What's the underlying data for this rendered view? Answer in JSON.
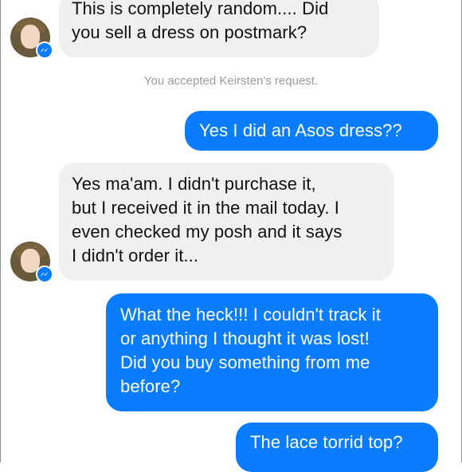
{
  "conversation": {
    "system_message": "You accepted Keirsten's request.",
    "messages": [
      {
        "sender": "other",
        "lines": [
          "This is completely random.... Did",
          "you sell a dress on postmark?"
        ]
      },
      {
        "sender": "me",
        "lines": [
          "Yes I did an Asos dress??"
        ]
      },
      {
        "sender": "other",
        "lines": [
          "Yes ma'am. I didn't purchase it,",
          "but I received it in the mail today. I",
          "even checked my posh and it says",
          "I didn't order it..."
        ]
      },
      {
        "sender": "me",
        "lines": [
          "What the heck!!! I couldn't track it",
          "or anything I thought it was lost!",
          "Did you buy something from me",
          "before?"
        ]
      },
      {
        "sender": "me",
        "lines": [
          "The lace torrid top?"
        ]
      }
    ]
  },
  "colors": {
    "outgoing_bubble": "#0a7cff",
    "incoming_bubble": "#f0f0f0",
    "system_text": "#9a9a9f"
  },
  "icons": {
    "avatar_badge": "messenger-badge-icon"
  }
}
